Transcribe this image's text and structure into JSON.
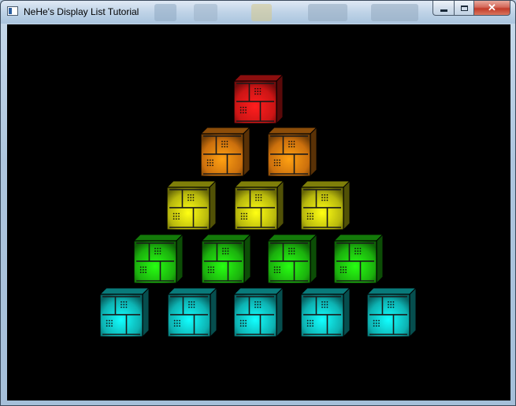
{
  "window": {
    "title": "NeHe's Display List Tutorial",
    "app_icon": "window-icon"
  },
  "caption_buttons": {
    "minimize_icon": "minimize-icon",
    "maximize_icon": "maximize-icon",
    "close_icon": "close-icon",
    "close_glyph": "✕"
  },
  "scene": {
    "background": "#000000",
    "rows": [
      {
        "color": "#ff1a1a",
        "count": 1
      },
      {
        "color": "#ff8c10",
        "count": 2
      },
      {
        "color": "#e6e610",
        "count": 3
      },
      {
        "color": "#22dd10",
        "count": 4
      },
      {
        "color": "#10dede",
        "count": 5
      }
    ]
  }
}
